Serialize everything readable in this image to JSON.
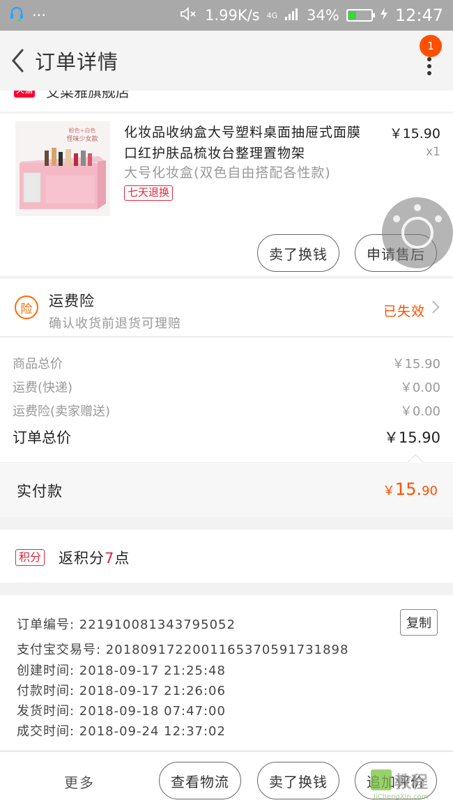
{
  "status_bar": {
    "speed": "1.99K/s",
    "network": "4G",
    "battery_percent": "34%",
    "battery_level": 0.34,
    "time": "12:47",
    "icons": [
      "headset-icon",
      "overflow-dots-icon",
      "mute-icon",
      "signal-icon",
      "battery-icon",
      "charging-icon"
    ]
  },
  "header": {
    "title": "订单详情",
    "badge_count": "1",
    "back_icon": "chevron-left-icon",
    "menu_icon": "more-vertical-icon"
  },
  "store": {
    "badge": "天猫",
    "name": "艾菜雅旗舰店"
  },
  "product": {
    "title": "化妆品收纳盒大号塑料桌面抽屉式面膜口红护肤品梳妆台整理置物架",
    "sku": "大号化妆盒(双色自由搭配各性款)",
    "tag": "七天退换",
    "price": "￥15.90",
    "quantity": "x1",
    "image_caption_top": "粉色+白色",
    "image_caption_bottom": "怪味少女款",
    "buttons": {
      "sell": "卖了换钱",
      "after_sale": "申请售后"
    }
  },
  "insurance": {
    "icon_text": "险",
    "title": "运费险",
    "subtitle": "确认收货前退货可理赔",
    "status": "已失效"
  },
  "costs": {
    "rows": [
      {
        "label": "商品总价",
        "value": "￥15.90"
      },
      {
        "label": "运费(快递)",
        "value": "￥0.00"
      },
      {
        "label": "运费险(卖家赠送)",
        "value": "￥0.00"
      }
    ],
    "total_label": "订单总价",
    "total_value": "￥15.90"
  },
  "payment": {
    "label": "实付款",
    "currency": "￥",
    "integer": "15.",
    "decimal": "90"
  },
  "points": {
    "tag": "积分",
    "prefix": "返积分",
    "number": "7",
    "suffix": "点"
  },
  "order_info": {
    "copy_button": "复制",
    "rows": [
      "订单编号: 221910081343795052",
      "支付宝交易号: 2018091722001165370591731898",
      "创建时间: 2018-09-17 21:25:48",
      "付款时间: 2018-09-17 21:26:06",
      "发货时间: 2018-09-18 07:47:00",
      "成交时间: 2018-09-24 12:37:02"
    ]
  },
  "bottom_bar": {
    "more": "更多",
    "logistics": "查看物流",
    "sell": "卖了换钱",
    "review": "追加评价"
  },
  "watermark": {
    "main": "教程",
    "sub": "JiChengXin.com"
  },
  "colors": {
    "accent": "#ff5000",
    "tag_red": "#e0263d",
    "status_bar": "#a9a9a9"
  }
}
